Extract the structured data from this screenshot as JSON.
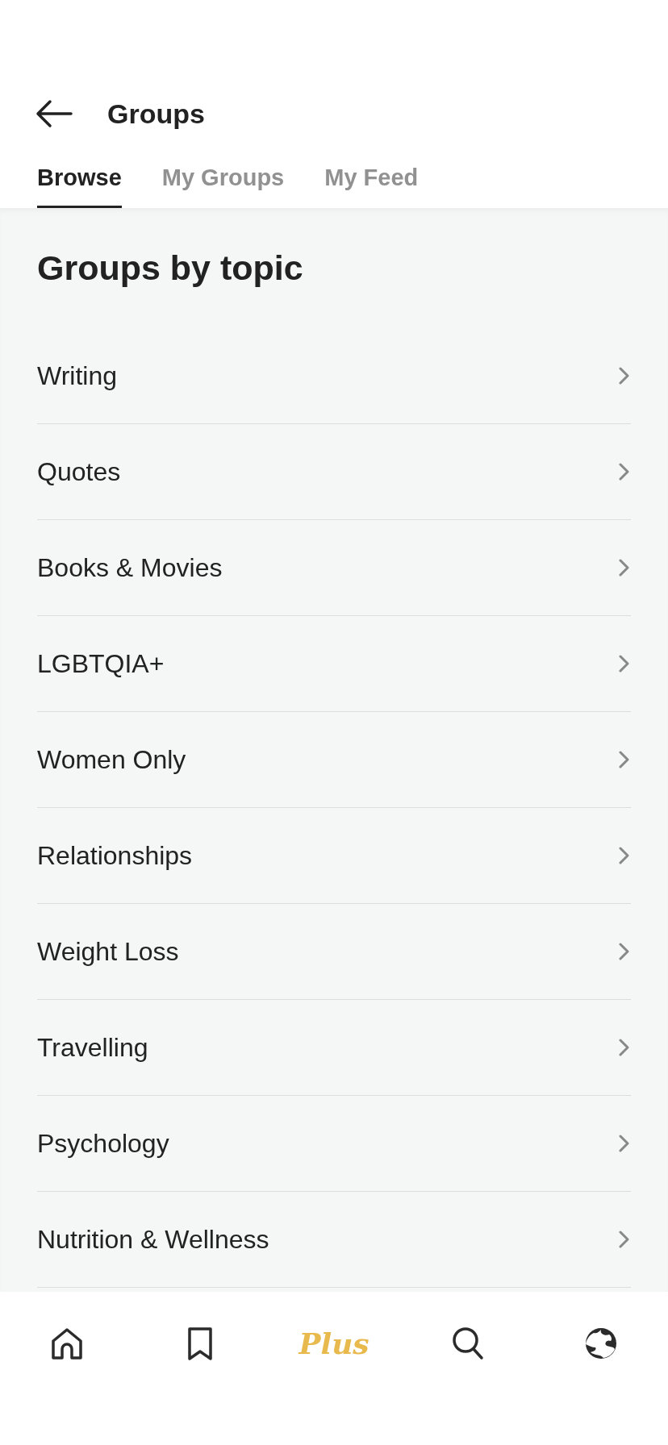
{
  "header": {
    "title": "Groups"
  },
  "tabs": [
    {
      "label": "Browse",
      "selected": true
    },
    {
      "label": "My Groups",
      "selected": false
    },
    {
      "label": "My Feed",
      "selected": false
    }
  ],
  "section": {
    "heading": "Groups by topic"
  },
  "topics": [
    {
      "label": "Writing"
    },
    {
      "label": "Quotes"
    },
    {
      "label": "Books & Movies"
    },
    {
      "label": "LGBTQIA+"
    },
    {
      "label": "Women Only"
    },
    {
      "label": "Relationships"
    },
    {
      "label": "Weight Loss"
    },
    {
      "label": "Travelling"
    },
    {
      "label": "Psychology"
    },
    {
      "label": "Nutrition & Wellness"
    }
  ],
  "nav": [
    {
      "kind": "home",
      "selected": false
    },
    {
      "kind": "bookmark",
      "selected": false
    },
    {
      "kind": "plus",
      "label": "Plus",
      "selected": true
    },
    {
      "kind": "search",
      "selected": false
    },
    {
      "kind": "profile",
      "selected": false
    }
  ]
}
